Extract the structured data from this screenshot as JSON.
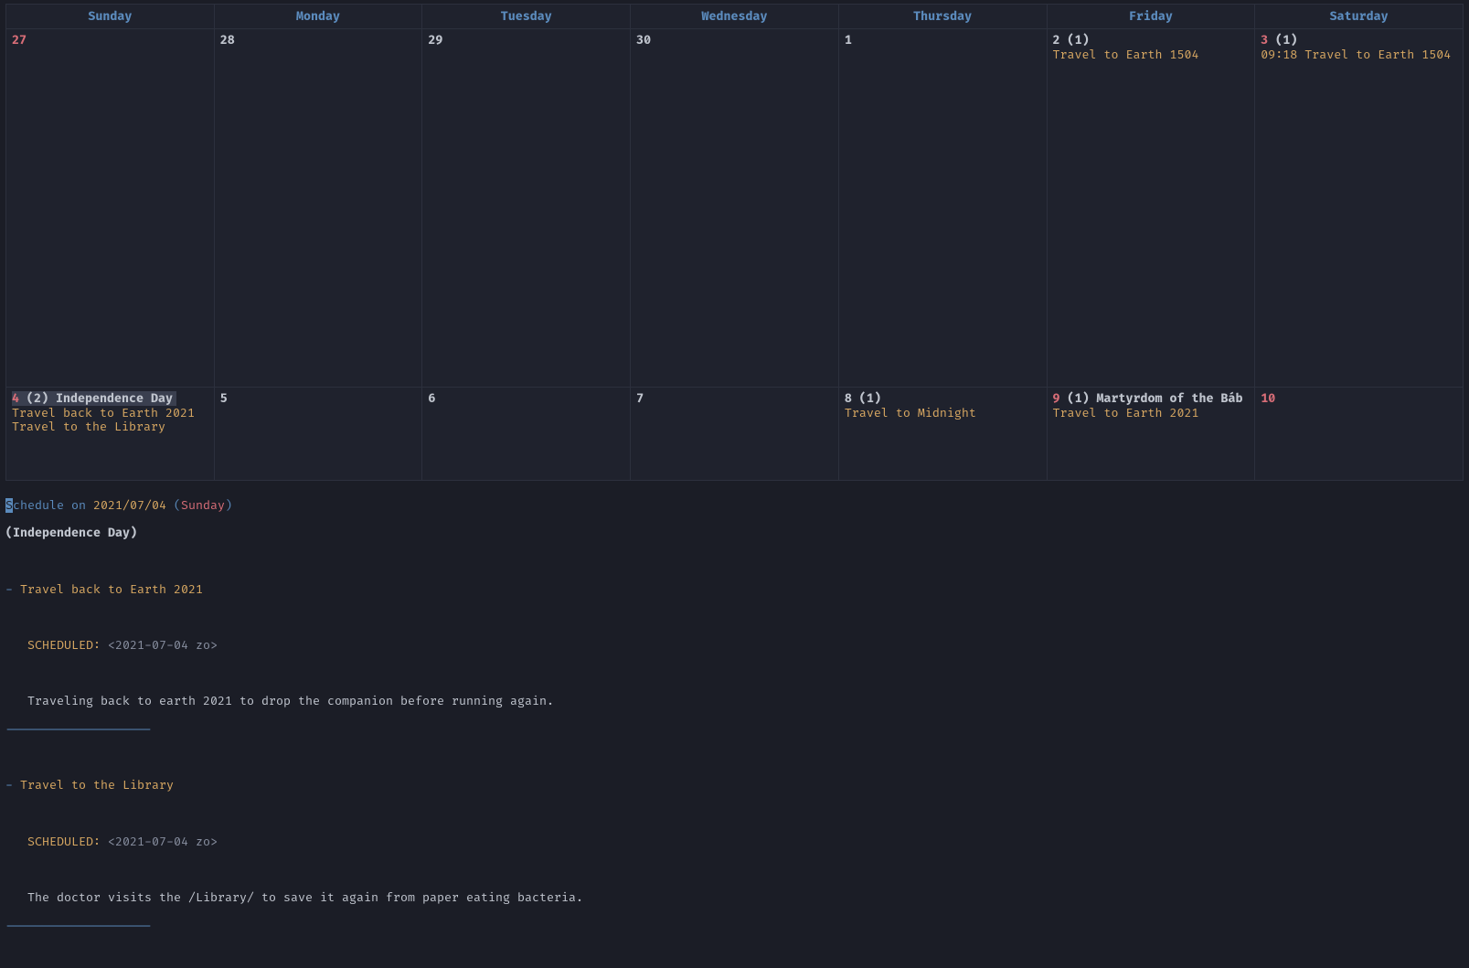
{
  "header": {
    "days": [
      "Sunday",
      "Monday",
      "Tuesday",
      "Wednesday",
      "Thursday",
      "Friday",
      "Saturday"
    ]
  },
  "row1": {
    "sun": {
      "num": "27"
    },
    "mon": {
      "num": "28"
    },
    "tue": {
      "num": "29"
    },
    "wed": {
      "num": "30"
    },
    "thu": {
      "num": "1"
    },
    "fri": {
      "num": "2",
      "count": "(1)",
      "ev1": "Travel to Earth 1504"
    },
    "sat": {
      "num": "3",
      "count": "(1)",
      "ev1": "09:18 Travel to Earth 1504"
    }
  },
  "row2": {
    "sun": {
      "num": "4",
      "count": "(2)",
      "holiday": "Independence Day",
      "ev1": "Travel back to Earth 2021",
      "ev2": "Travel to the Library"
    },
    "mon": {
      "num": "5"
    },
    "tue": {
      "num": "6"
    },
    "wed": {
      "num": "7"
    },
    "thu": {
      "num": "8",
      "count": "(1)",
      "ev1": "Travel to Midnight"
    },
    "fri": {
      "num": "9",
      "count": "(1)",
      "holiday": "Martyrdom of the Báb",
      "ev1": "Travel to Earth 2021"
    },
    "sat": {
      "num": "10"
    }
  },
  "detail": {
    "cursor": "S",
    "title_prefix": "chedule on ",
    "title_date": "2021/07/04",
    "title_open": " (",
    "title_day": "Sunday",
    "title_close": ")",
    "sub": "(Independence Day)",
    "bullet": "- ",
    "item1": "Travel back to Earth 2021",
    "sched_key": "   SCHEDULED: ",
    "sched_val": "<2021-07-04 zo>",
    "body1": "   Traveling back to earth 2021 to drop the companion before running again.",
    "rule": "--------------------",
    "item2": "Travel to the Library",
    "sched_val2": "<2021-07-04 zo>",
    "body2": "   The doctor visits the /Library/ to save it again from paper eating bacteria."
  }
}
